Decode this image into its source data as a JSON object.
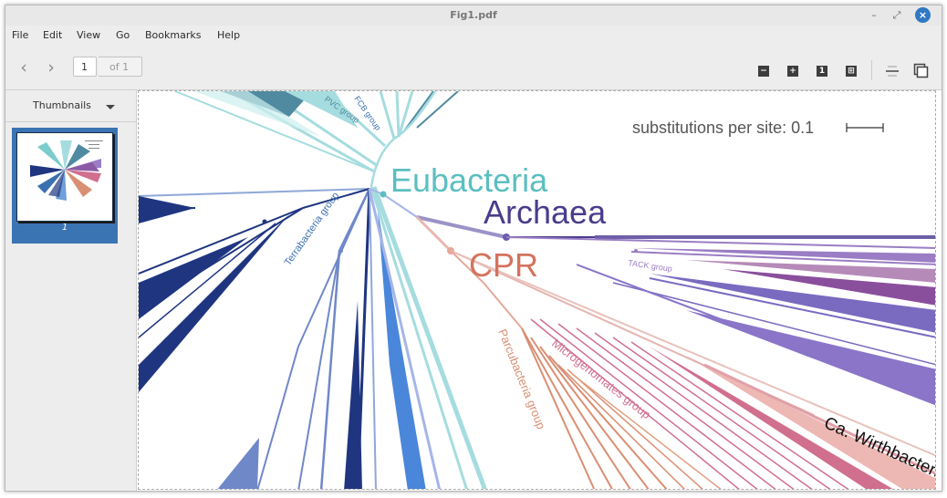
{
  "window": {
    "title": "Fig1.pdf",
    "minimize_glyph": "–",
    "restore_glyph": "⤢",
    "close_glyph": "×"
  },
  "menu": [
    "File",
    "Edit",
    "View",
    "Go",
    "Bookmarks",
    "Help"
  ],
  "toolbar": {
    "back_glyph": "‹",
    "forward_glyph": "›",
    "page_value": "1",
    "page_total": "of 1",
    "icons": [
      "zoom-out-icon",
      "zoom-in-icon",
      "fit-page-icon",
      "fit-width-icon",
      "continuous-icon",
      "dual-page-icon"
    ],
    "zoom_out_glyph": "−",
    "zoom_in_glyph": "+",
    "fit_page_glyph": "1",
    "fit_width_glyph": "⊞"
  },
  "sidebar": {
    "title": "Thumbnails",
    "thumbnails": [
      {
        "page_label": "1"
      }
    ]
  },
  "figure": {
    "scale_label": "substitutions per site: 0.1",
    "labels": {
      "eubacteria": "Eubacteria",
      "archaea": "Archaea",
      "cpr": "CPR",
      "terrabacteria": "Terrabacteria group",
      "pvc": "PVC group",
      "fcb": "FCB group",
      "tack": "TACK group",
      "parcubacteria": "Parcubacteria group",
      "microgenomates": "Microgenomates group",
      "wirthbacteria": "Ca. Wirthbacteria"
    },
    "colors": {
      "eubacteria": "#5bbfc0",
      "archaea": "#4a3c8c",
      "cpr": "#d4735e",
      "terrabacteria": "#3a6fb0",
      "dark_blue": "#1f3580",
      "tack": "#9a7dc4",
      "parcubacteria": "#d98f73",
      "microgenomates": "#d06f8e",
      "teal_light": "#a5dcdf",
      "teal_dark": "#4f8aa0"
    }
  }
}
